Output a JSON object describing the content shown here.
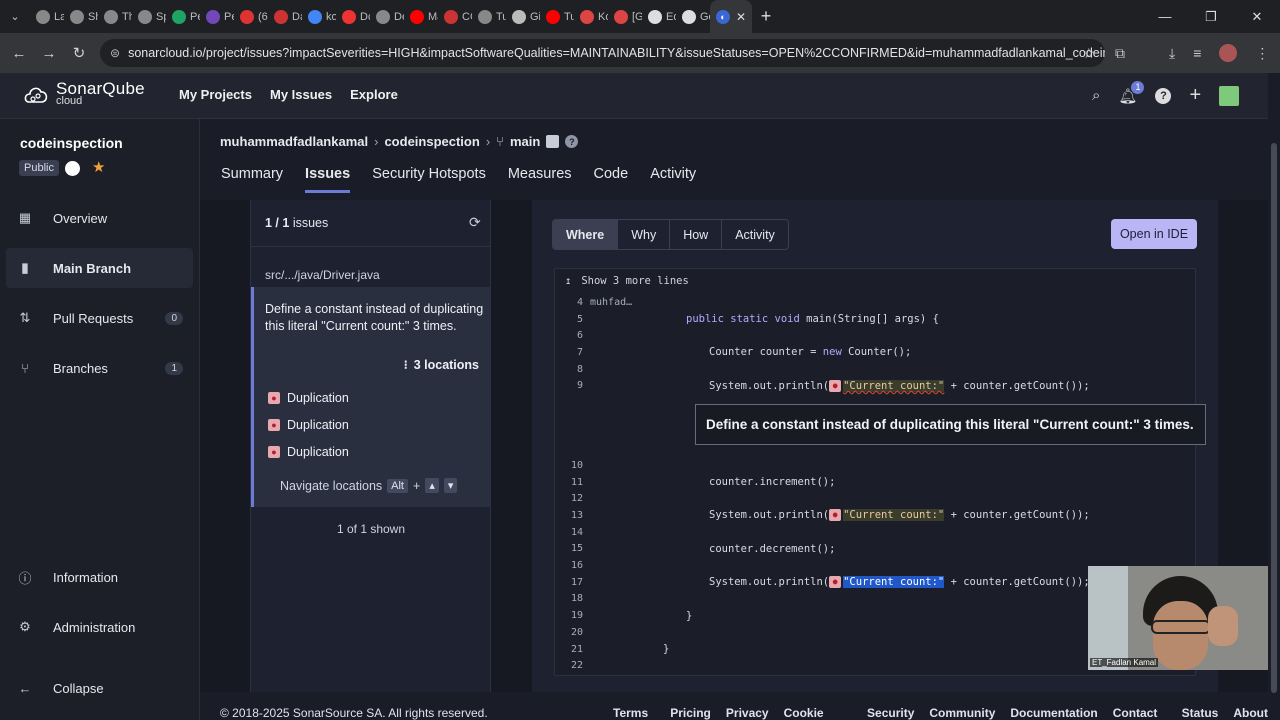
{
  "browser": {
    "tabs": [
      {
        "label": "La",
        "icon": "globe-icon",
        "color": "#888"
      },
      {
        "label": "Sh",
        "icon": "grid-icon",
        "color": "#888"
      },
      {
        "label": "Th",
        "icon": "globe-icon",
        "color": "#888"
      },
      {
        "label": "Sp",
        "icon": "github-icon",
        "color": "#888"
      },
      {
        "label": "Pe",
        "icon": "sheets-icon",
        "color": "#1fa463"
      },
      {
        "label": "Pe",
        "icon": "forms-icon",
        "color": "#7248b9"
      },
      {
        "label": "(6)",
        "icon": "red-icon",
        "color": "#d33"
      },
      {
        "label": "Da",
        "icon": "red-icon",
        "color": "#c33"
      },
      {
        "label": "ko",
        "icon": "google-icon",
        "color": "#4285f4"
      },
      {
        "label": "Dc",
        "icon": "heart-icon",
        "color": "#e33"
      },
      {
        "label": "De",
        "icon": "globe-icon",
        "color": "#888"
      },
      {
        "label": "Ma",
        "icon": "youtube-icon",
        "color": "#f00"
      },
      {
        "label": "CC",
        "icon": "cc-icon",
        "color": "#c33"
      },
      {
        "label": "Tu",
        "icon": "globe-icon",
        "color": "#888"
      },
      {
        "label": "Gi",
        "icon": "openai-icon",
        "color": "#bbb"
      },
      {
        "label": "Tu",
        "icon": "youtube-icon",
        "color": "#f00"
      },
      {
        "label": "Ko",
        "icon": "gmail-icon",
        "color": "#d44"
      },
      {
        "label": "[G",
        "icon": "gmail-icon",
        "color": "#d44"
      },
      {
        "label": "Ed",
        "icon": "github-icon",
        "color": "#ddd"
      },
      {
        "label": "Gc",
        "icon": "chrome-icon",
        "color": "#ddd"
      }
    ],
    "active_tab_icon": "sonar-icon",
    "url": "sonarcloud.io/project/issues?impactSeverities=HIGH&impactSoftwareQualities=MAINTAINABILITY&issueStatuses=OPEN%2CCONFIRMED&id=muhammadfadlankamal_codeinspecti..."
  },
  "sonar_nav": {
    "logo_main": "SonarQube",
    "logo_sub": "cloud",
    "links": [
      "My Projects",
      "My Issues",
      "Explore"
    ],
    "notification_count": "1"
  },
  "sidebar": {
    "project_name": "codeinspection",
    "visibility": "Public",
    "items": [
      {
        "label": "Overview",
        "icon": "overview-icon"
      },
      {
        "label": "Main Branch",
        "icon": "branch-icon",
        "active": true
      },
      {
        "label": "Pull Requests",
        "icon": "pull-request-icon",
        "count": "0"
      },
      {
        "label": "Branches",
        "icon": "branches-icon",
        "count": "1"
      }
    ],
    "bottom_items": [
      {
        "label": "Information",
        "icon": "info-icon"
      },
      {
        "label": "Administration",
        "icon": "gear-icon"
      },
      {
        "label": "Collapse",
        "icon": "collapse-arrow-icon"
      }
    ]
  },
  "breadcrumb": {
    "org": "muhammadfadlankamal",
    "project": "codeinspection",
    "branch": "main"
  },
  "project_tabs": [
    "Summary",
    "Issues",
    "Security Hotspots",
    "Measures",
    "Code",
    "Activity"
  ],
  "issue_list": {
    "count_strong": "1 / 1",
    "count_suffix": "issues",
    "file_path": "src/.../java/Driver.java",
    "issue_message": "Define a constant instead of duplicating this literal \"Current count:\" 3 times.",
    "locations_label": "3 locations",
    "locations": [
      "Duplication",
      "Duplication",
      "Duplication"
    ],
    "navigate_label": "Navigate locations",
    "alt_key": "Alt",
    "plus": "+",
    "shown_label": "1 of 1 shown"
  },
  "detail": {
    "tabs": [
      "Where",
      "Why",
      "How",
      "Activity"
    ],
    "open_ide": "Open in IDE",
    "show_more": "Show 3 more lines",
    "blame_author": "muhfad…",
    "tooltip": "Define a constant instead of duplicating this literal \"Current count:\" 3 times.",
    "lines": [
      {
        "n": "4",
        "code": ""
      },
      {
        "n": "5",
        "code": "public static void main(String[] args) {"
      },
      {
        "n": "6",
        "code": ""
      },
      {
        "n": "7",
        "code": "Counter counter = new Counter();"
      },
      {
        "n": "8",
        "code": ""
      },
      {
        "n": "9",
        "code": "System.out.println(\"Current count:\" + counter.getCount());"
      },
      {
        "n": "10",
        "code": ""
      },
      {
        "n": "11",
        "code": "counter.increment();"
      },
      {
        "n": "12",
        "code": ""
      },
      {
        "n": "13",
        "code": "System.out.println(\"Current count:\" + counter.getCount());"
      },
      {
        "n": "14",
        "code": ""
      },
      {
        "n": "15",
        "code": "counter.decrement();"
      },
      {
        "n": "16",
        "code": ""
      },
      {
        "n": "17",
        "code": "System.out.println(\"Current count:\" + counter.getCount());"
      },
      {
        "n": "18",
        "code": ""
      },
      {
        "n": "19",
        "code": "}"
      },
      {
        "n": "20",
        "code": ""
      },
      {
        "n": "21",
        "code": "}"
      },
      {
        "n": "22",
        "code": ""
      }
    ]
  },
  "footer": {
    "copyright": "© 2018-2025 SonarSource SA. All rights reserved.",
    "links": [
      "Terms",
      "Pricing",
      "Privacy",
      "Cookie Policy",
      "Security",
      "Community",
      "Documentation",
      "Contact us",
      "Status",
      "About"
    ]
  },
  "webcam": {
    "label": "ET_Fadlan Kamal"
  }
}
